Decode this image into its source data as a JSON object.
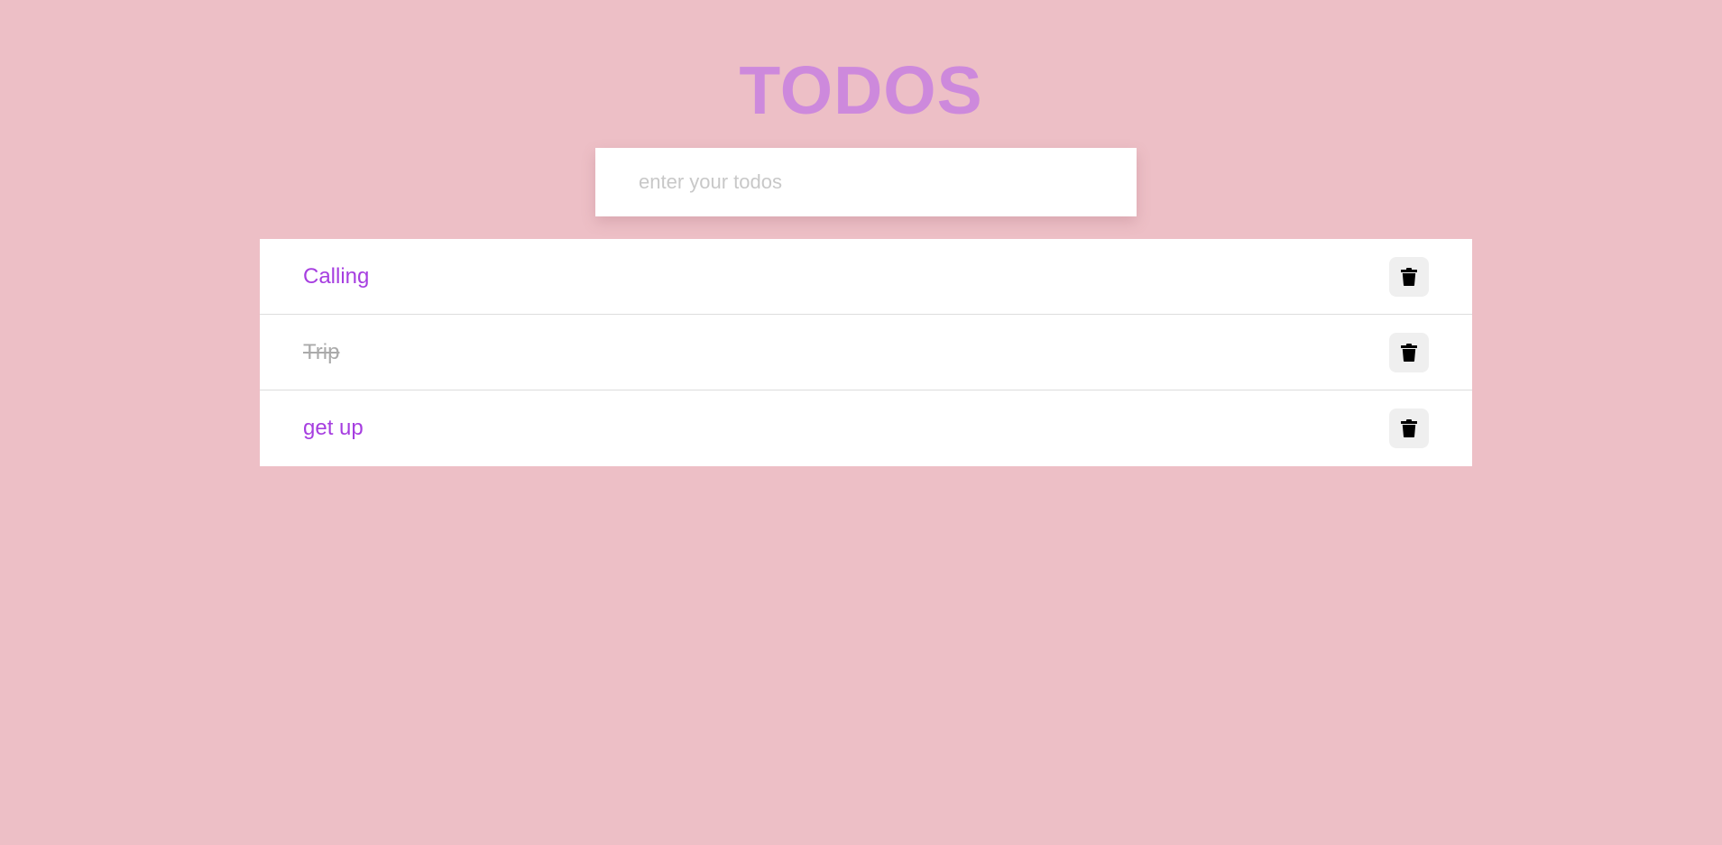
{
  "header": {
    "title": "TODOS"
  },
  "input": {
    "placeholder": "enter your todos",
    "value": ""
  },
  "todos": [
    {
      "text": "Calling",
      "completed": false
    },
    {
      "text": "Trip",
      "completed": true
    },
    {
      "text": "get up",
      "completed": false
    }
  ],
  "icons": {
    "delete": "trash-icon"
  },
  "colors": {
    "background": "#edbfc6",
    "title": "#cd89dc",
    "todo_text": "#a63ee0",
    "completed_text": "#aaaaaa",
    "card": "#ffffff",
    "delete_button_bg": "#efefef"
  }
}
